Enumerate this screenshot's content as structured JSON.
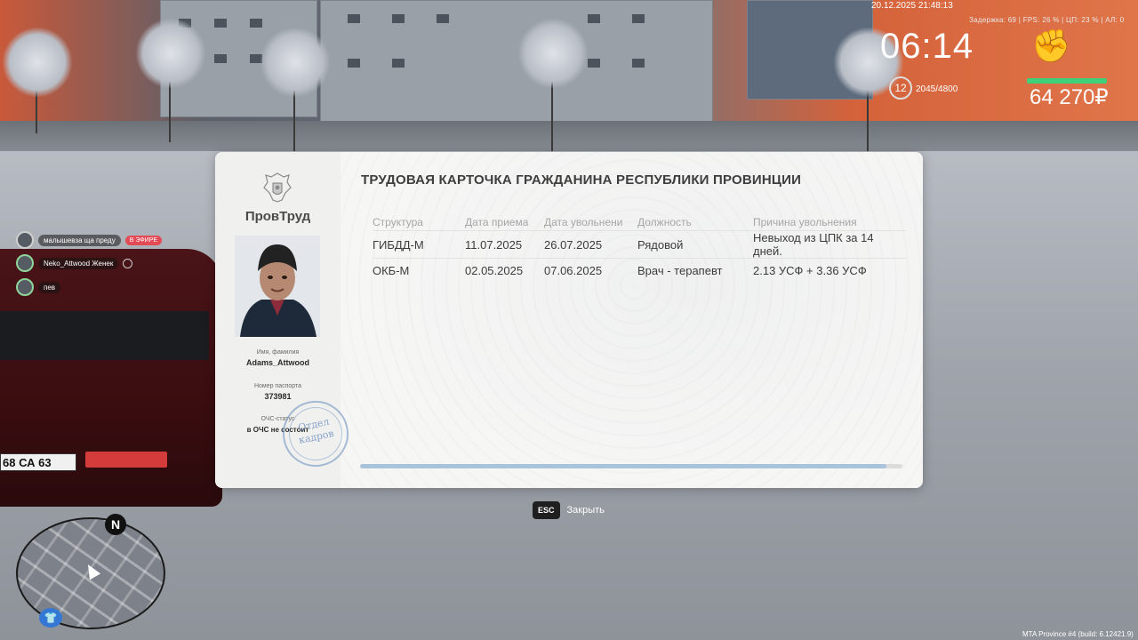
{
  "hud": {
    "datetime": "20.12.2025 21:48:13",
    "stats": "Задержка: 69 | FPS: 26 % | ЦП: 23 % | АЛ: 0",
    "clock": "06:14",
    "money": "64 270₽",
    "level": "12",
    "xp": "2045/4800",
    "health_fraction": 0.9
  },
  "voice_chat": [
    {
      "name": "малышевза ща преду",
      "badge": "В ЭФИРЕ"
    },
    {
      "name": "Neko_Attwood Женек",
      "badge": ""
    },
    {
      "name": "пев",
      "badge": ""
    }
  ],
  "card": {
    "brand": "ПровТруд",
    "title": "ТРУДОВАЯ КАРТОЧКА ГРАЖДАНИНА РЕСПУБЛИКИ ПРОВИНЦИИ",
    "name_label": "Имя, фамилия",
    "name_value": "Adams_Attwood",
    "passport_label": "Номер паспорта",
    "passport_value": "373981",
    "status_label": "ОЧС-статус",
    "status_value": "в ОЧС не состоит",
    "stamp_line1": "Отдел",
    "stamp_line2": "кадров",
    "columns": [
      "Структура",
      "Дата приема",
      "Дата увольнени",
      "Должность",
      "Причина увольнения"
    ],
    "rows": [
      [
        "ГИБДД-М",
        "11.07.2025",
        "26.07.2025",
        "Рядовой",
        "Невыход из ЦПК за 14 дней."
      ],
      [
        "ОКБ-М",
        "02.05.2025",
        "07.06.2025",
        "Врач - терапевт",
        "2.13 УСФ + 3.36 УСФ"
      ]
    ],
    "scroll_fraction": 0.97
  },
  "close_hint": {
    "key": "ESC",
    "label": "Закрыть"
  },
  "minimap": {
    "north": "N"
  },
  "car_plate": "68 СА 63",
  "build": "MTA Province #4 (build: 6.12421.9)"
}
